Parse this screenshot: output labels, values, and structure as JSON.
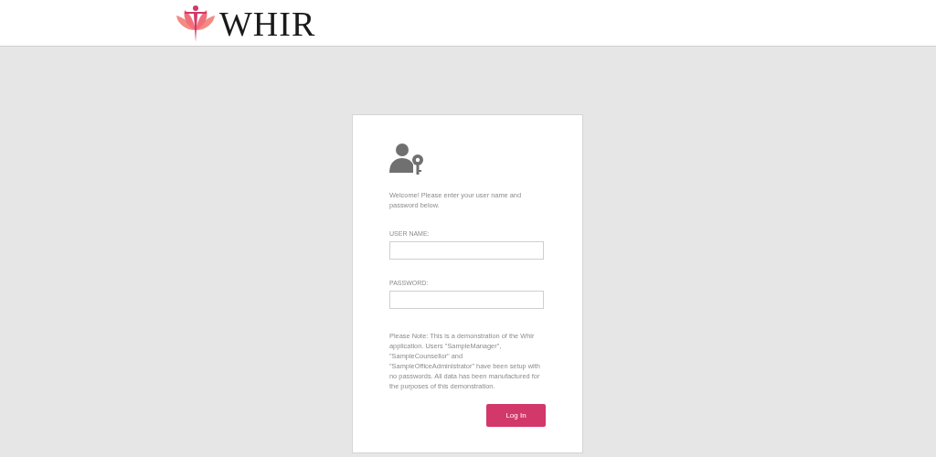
{
  "header": {
    "logo_text": "WHIR"
  },
  "login": {
    "welcome": "Welcome! Please enter your user name and password below.",
    "fields": [
      {
        "label": "USER NAME:"
      },
      {
        "label": "PASSWORD:"
      }
    ],
    "note": "Please Note: This is a demonstration of the Whir application. Users \"SampleManager\", \"SampleCounsellor\" and \"SampleOfficeAdministrator\" have been setup with no passwords. All data has been manufactured for the purposes of this demonstration.",
    "button": "Log In"
  }
}
